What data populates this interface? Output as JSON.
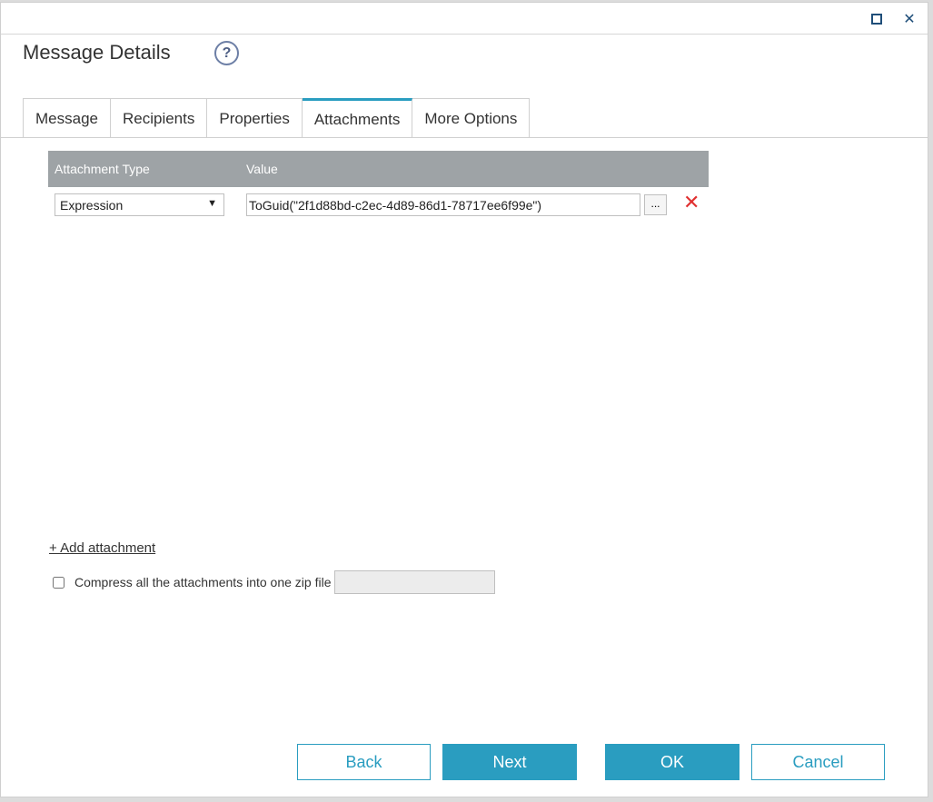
{
  "dialog": {
    "title": "Message Details",
    "help_icon": "?",
    "window_buttons": {
      "maximize_icon": "maximize-icon",
      "close_icon": "close-icon",
      "close_glyph": "✕"
    }
  },
  "tabs": [
    {
      "label": "Message"
    },
    {
      "label": "Recipients"
    },
    {
      "label": "Properties"
    },
    {
      "label": "Attachments",
      "active": true
    },
    {
      "label": "More Options"
    }
  ],
  "attachments_grid": {
    "headers": {
      "type": "Attachment Type",
      "value": "Value"
    },
    "rows": [
      {
        "type": "Expression",
        "value": "ToGuid(\"2f1d88bd-c2ec-4d89-86d1-78717ee6f99e\")",
        "browse_label": "...",
        "delete_glyph": "✕"
      }
    ]
  },
  "add_attachment_label": "+ Add attachment",
  "compress": {
    "label": "Compress all the attachments into one zip file",
    "checked": false,
    "value": ""
  },
  "buttons": {
    "back": "Back",
    "next": "Next",
    "ok": "OK",
    "cancel": "Cancel"
  },
  "colors": {
    "accent": "#2a9dc0",
    "header_bg": "#9ea3a6",
    "delete": "#e03030"
  }
}
